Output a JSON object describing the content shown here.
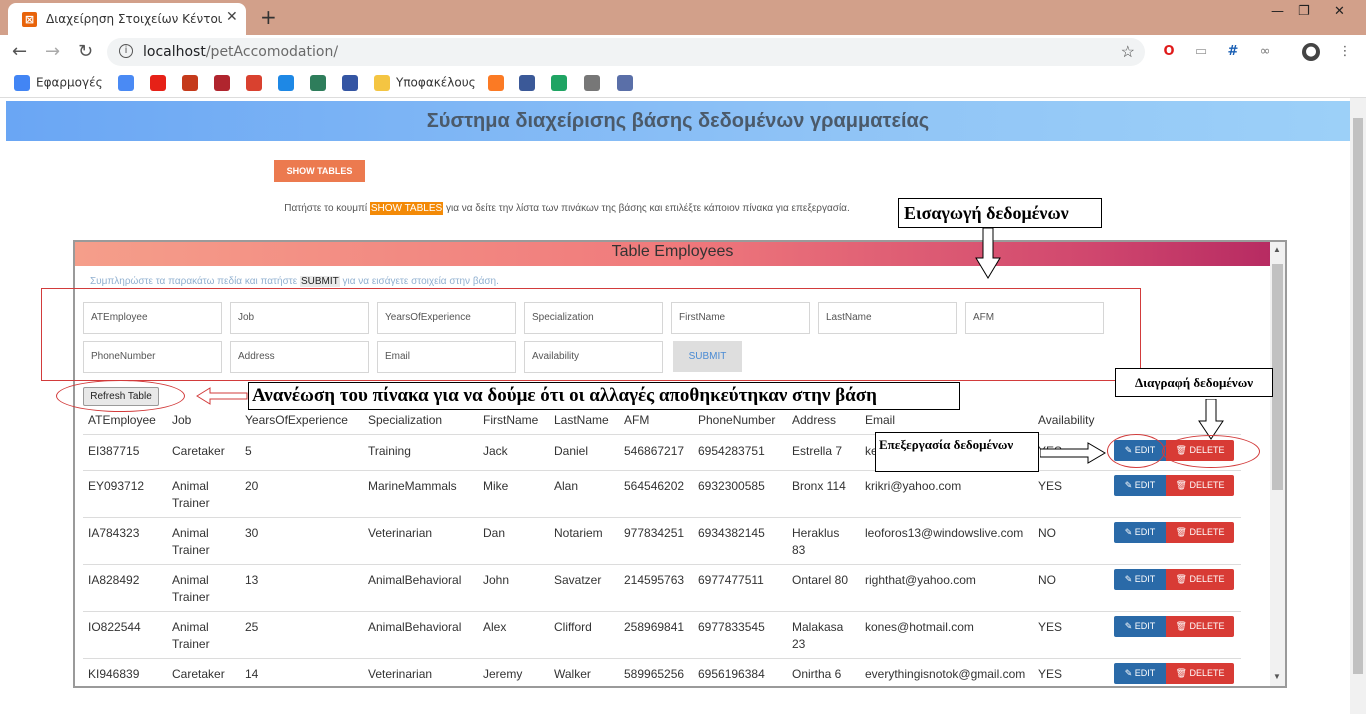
{
  "browser": {
    "tab_title": "Διαχείρηση Στοιχείων Κέντου φ",
    "tab_close": "✕",
    "new_tab": "+",
    "window_controls": [
      "—",
      "❐",
      "✕"
    ],
    "url_host": "localhost",
    "url_path": "/petAccomodation/",
    "bookmarks": [
      {
        "label": "Εφαρμογές",
        "icon": "apps-grid-icon",
        "color": "#4285f4"
      },
      {
        "label": "",
        "icon": "translate-icon",
        "color": "#4a8af4"
      },
      {
        "label": "",
        "icon": "youtube-icon",
        "color": "#e62117"
      },
      {
        "label": "",
        "icon": "wordreference-icon",
        "color": "#c53a1b"
      },
      {
        "label": "",
        "icon": "shield-icon",
        "color": "#b0252e"
      },
      {
        "label": "",
        "icon": "c-icon",
        "color": "#d9412f"
      },
      {
        "label": "",
        "icon": "p-icon",
        "color": "#1e88e5"
      },
      {
        "label": "",
        "icon": "books-icon",
        "color": "#2e7d5b"
      },
      {
        "label": "",
        "icon": "globe-icon",
        "color": "#3455a3"
      },
      {
        "label": "Υποφακέλους",
        "icon": "folder-icon",
        "color": "#f4c542"
      },
      {
        "label": "",
        "icon": "xampp-icon",
        "color": "#fb7a24"
      },
      {
        "label": "",
        "icon": "facebook-icon",
        "color": "#3b5998"
      },
      {
        "label": "",
        "icon": "drive-icon",
        "color": "#1fa463"
      },
      {
        "label": "",
        "icon": "world-icon",
        "color": "#777777"
      },
      {
        "label": "",
        "icon": "bookmark-app-icon",
        "color": "#5a6fa8"
      }
    ]
  },
  "page": {
    "title": "Σύστημα διαχείρισης βάσης δεδομένων γραμματείας",
    "show_tables_button": "SHOW TABLES",
    "hint_before": "Πατήστε το κουμπί ",
    "hint_highlight": "SHOW TABLES",
    "hint_after": " για να δείτε την λίστα των πινάκων της βάσης και επιλέξτε κάποιον πίνακα για επεξεργασία."
  },
  "table_frame": {
    "title": "Table Employees",
    "instruction_before": "Συμπληρώστε τα παρακάτω πεδία και πατήστε ",
    "instruction_highlight": "SUBMIT",
    "instruction_after": " για να εισάγετε στοιχεία στην βάση.",
    "fields": [
      "ATEmployee",
      "Job",
      "YearsOfExperience",
      "Specialization",
      "FirstName",
      "LastName",
      "AFM",
      "PhoneNumber",
      "Address",
      "Email",
      "Availability"
    ],
    "submit_label": "SUBMIT",
    "refresh_label": "Refresh Table",
    "columns": [
      "ATEmployee",
      "Job",
      "YearsOfExperience",
      "Specialization",
      "FirstName",
      "LastName",
      "AFM",
      "PhoneNumber",
      "Address",
      "Email",
      "Availability"
    ],
    "edit_label": "EDIT",
    "delete_label": "DELETE",
    "rows": [
      {
        "at": "EI387715",
        "job1": "Caretaker",
        "job2": "",
        "years": "5",
        "spec": "Training",
        "first": "Jack",
        "last": "Daniel",
        "afm": "546867217",
        "phone": "6954283751",
        "addr1": "Estrella 7",
        "addr2": "",
        "email": "ke",
        "avail": "YES"
      },
      {
        "at": "EY093712",
        "job1": "Animal",
        "job2": "Trainer",
        "years": "20",
        "spec": "MarineMammals",
        "first": "Mike",
        "last": "Alan",
        "afm": "564546202",
        "phone": "6932300585",
        "addr1": "Bronx 114",
        "addr2": "",
        "email": "krikri@yahoo.com",
        "avail": "YES"
      },
      {
        "at": "IA784323",
        "job1": "Animal",
        "job2": "Trainer",
        "years": "30",
        "spec": "Veterinarian",
        "first": "Dan",
        "last": "Notariem",
        "afm": "977834251",
        "phone": "6934382145",
        "addr1": "Heraklus",
        "addr2": "83",
        "email": "leoforos13@windowslive.com",
        "avail": "NO"
      },
      {
        "at": "IA828492",
        "job1": "Animal",
        "job2": "Trainer",
        "years": "13",
        "spec": "AnimalBehavioral",
        "first": "John",
        "last": "Savatzer",
        "afm": "214595763",
        "phone": "6977477511",
        "addr1": "Ontarel 80",
        "addr2": "",
        "email": "righthat@yahoo.com",
        "avail": "NO"
      },
      {
        "at": "IO822544",
        "job1": "Animal",
        "job2": "Trainer",
        "years": "25",
        "spec": "AnimalBehavioral",
        "first": "Alex",
        "last": "Clifford",
        "afm": "258969841",
        "phone": "6977833545",
        "addr1": "Malakasa",
        "addr2": "23",
        "email": "kones@hotmail.com",
        "avail": "YES"
      },
      {
        "at": "KI946839",
        "job1": "Caretaker",
        "job2": "",
        "years": "14",
        "spec": "Veterinarian",
        "first": "Jeremy",
        "last": "Walker",
        "afm": "589965256",
        "phone": "6956196384",
        "addr1": "Onirtha 6",
        "addr2": "",
        "email": "everythingisnotok@gmail.com",
        "avail": "YES"
      }
    ]
  },
  "annotations": {
    "insert_data": "Εισαγωγή δεδομένων",
    "refresh_note": "Ανανέωση του πίνακα για να δούμε ότι οι αλλαγές αποθηκεύτηκαν στην βάση",
    "delete_data": "Διαγραφή δεδομένων",
    "edit_data": "Επεξεργασία δεδομένων"
  }
}
